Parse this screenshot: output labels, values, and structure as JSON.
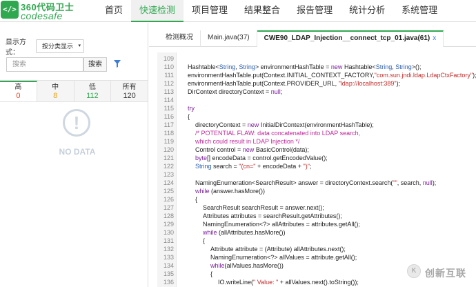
{
  "app": {
    "logo_cn": "360代码卫士",
    "logo_en": "codesafe",
    "logo_glyph": "</>"
  },
  "nav": [
    {
      "label": "首页",
      "active": false
    },
    {
      "label": "快速检测",
      "active": true
    },
    {
      "label": "项目管理",
      "active": false
    },
    {
      "label": "结果整合",
      "active": false
    },
    {
      "label": "报告管理",
      "active": false
    },
    {
      "label": "统计分析",
      "active": false
    },
    {
      "label": "系统管理",
      "active": false
    }
  ],
  "left_panel": {
    "display_label": "显示方式：",
    "display_value": "按分类显示",
    "search_placeholder": "搜索",
    "search_button": "搜索",
    "severity_tabs": [
      {
        "label": "高",
        "count": "0"
      },
      {
        "label": "中",
        "count": "8"
      },
      {
        "label": "低",
        "count": "112"
      },
      {
        "label": "所有",
        "count": "120"
      }
    ],
    "no_data_icon": "!",
    "no_data_text": "NO DATA"
  },
  "tabs": [
    {
      "label": "检测概况",
      "active": false
    },
    {
      "label": "Main.java(37)",
      "active": false
    },
    {
      "label": "CWE90_LDAP_Injection__connect_tcp_01.java(61)",
      "active": true,
      "close": "x"
    }
  ],
  "code": {
    "lines": [
      {
        "n": "109",
        "indent": 0,
        "parts": [
          [
            "",
            ""
          ]
        ]
      },
      {
        "n": "110",
        "indent": 0,
        "parts": [
          [
            "",
            "Hashtable<"
          ],
          [
            "ty",
            "String"
          ],
          [
            "",
            ", "
          ],
          [
            "ty",
            "String"
          ],
          [
            "",
            "> environmentHashTable = "
          ],
          [
            "kw",
            "new"
          ],
          [
            "",
            " Hashtable<"
          ],
          [
            "ty",
            "String"
          ],
          [
            "",
            ", "
          ],
          [
            "ty",
            "String"
          ],
          [
            "",
            ">();"
          ]
        ]
      },
      {
        "n": "111",
        "indent": 0,
        "parts": [
          [
            "",
            "environmentHashTable.put(Context.INITIAL_CONTEXT_FACTORY,"
          ],
          [
            "st",
            "\"com.sun.jndi.ldap.LdapCtxFactory\""
          ],
          [
            "",
            ");"
          ]
        ]
      },
      {
        "n": "112",
        "indent": 0,
        "parts": [
          [
            "",
            "environmentHashTable.put(Context.PROVIDER_URL, "
          ],
          [
            "st",
            "\"ldap://localhost:389\""
          ],
          [
            "",
            ");"
          ]
        ]
      },
      {
        "n": "113",
        "indent": 0,
        "parts": [
          [
            "",
            "DirContext directoryContext = "
          ],
          [
            "kw",
            "null"
          ],
          [
            "",
            ";"
          ]
        ]
      },
      {
        "n": "114",
        "indent": 0,
        "parts": [
          [
            "",
            ""
          ]
        ]
      },
      {
        "n": "115",
        "indent": 0,
        "parts": [
          [
            "kw",
            "try"
          ]
        ]
      },
      {
        "n": "116",
        "indent": 0,
        "parts": [
          [
            "",
            "{"
          ]
        ]
      },
      {
        "n": "117",
        "indent": 1,
        "parts": [
          [
            "",
            "directoryContext = "
          ],
          [
            "kw",
            "new"
          ],
          [
            "",
            " InitialDirContext(environmentHashTable);"
          ]
        ]
      },
      {
        "n": "118",
        "indent": 1,
        "parts": [
          [
            "cm",
            "/* POTENTIAL FLAW: data concatenated into LDAP search,"
          ]
        ]
      },
      {
        "n": "119",
        "indent": 1,
        "parts": [
          [
            "cm",
            "which could result in LDAP Injection */"
          ]
        ]
      },
      {
        "n": "120",
        "indent": 1,
        "parts": [
          [
            "",
            "Control control = "
          ],
          [
            "kw",
            "new"
          ],
          [
            "",
            " BasicControl(data);"
          ]
        ]
      },
      {
        "n": "121",
        "indent": 1,
        "parts": [
          [
            "kw",
            "byte"
          ],
          [
            "",
            "[] encodeData = control.getEncodedValue();"
          ]
        ]
      },
      {
        "n": "122",
        "indent": 1,
        "parts": [
          [
            "ty",
            "String"
          ],
          [
            "",
            " search = "
          ],
          [
            "st",
            "\"(cn=\""
          ],
          [
            "",
            " + encodeData + "
          ],
          [
            "st",
            "\")\""
          ],
          [
            "",
            ";"
          ]
        ]
      },
      {
        "n": "123",
        "indent": 0,
        "parts": [
          [
            "",
            ""
          ]
        ]
      },
      {
        "n": "124",
        "indent": 1,
        "parts": [
          [
            "",
            "NamingEnumeration<SearchResult> answer = directoryContext.search("
          ],
          [
            "st",
            "\"\""
          ],
          [
            "",
            ", search, "
          ],
          [
            "kw",
            "null"
          ],
          [
            "",
            ");"
          ]
        ]
      },
      {
        "n": "125",
        "indent": 1,
        "parts": [
          [
            "kw",
            "while"
          ],
          [
            "",
            " (answer.hasMore())"
          ]
        ]
      },
      {
        "n": "126",
        "indent": 1,
        "parts": [
          [
            "",
            "{"
          ]
        ]
      },
      {
        "n": "127",
        "indent": 2,
        "parts": [
          [
            "",
            "SearchResult searchResult = answer.next();"
          ]
        ]
      },
      {
        "n": "128",
        "indent": 2,
        "parts": [
          [
            "",
            "Attributes attributes = searchResult.getAttributes();"
          ]
        ]
      },
      {
        "n": "129",
        "indent": 2,
        "parts": [
          [
            "",
            "NamingEnumeration<?> allAttributes = attributes.getAll();"
          ]
        ]
      },
      {
        "n": "130",
        "indent": 2,
        "parts": [
          [
            "kw",
            "while"
          ],
          [
            "",
            " (allAttributes.hasMore())"
          ]
        ]
      },
      {
        "n": "131",
        "indent": 2,
        "parts": [
          [
            "",
            "{"
          ]
        ]
      },
      {
        "n": "132",
        "indent": 3,
        "parts": [
          [
            "",
            "Attribute attribute = (Attribute) allAttributes.next();"
          ]
        ]
      },
      {
        "n": "133",
        "indent": 3,
        "parts": [
          [
            "",
            "NamingEnumeration<?> allValues = attribute.getAll();"
          ]
        ]
      },
      {
        "n": "134",
        "indent": 3,
        "parts": [
          [
            "kw",
            "while"
          ],
          [
            "",
            "(allValues.hasMore())"
          ]
        ]
      },
      {
        "n": "135",
        "indent": 3,
        "parts": [
          [
            "",
            "{"
          ]
        ]
      },
      {
        "n": "136",
        "indent": 4,
        "parts": [
          [
            "",
            "IO.writeLine("
          ],
          [
            "st",
            "\" Value: \""
          ],
          [
            "",
            " + allValues.next().toString());"
          ]
        ]
      }
    ]
  },
  "watermark": {
    "glyph": "K",
    "text": "创新互联"
  },
  "colors": {
    "brand": "#2fa84f",
    "keyword": "#7a1f9c",
    "type": "#2a5db0",
    "string": "#c42a2a",
    "comment": "#c02a9a"
  }
}
